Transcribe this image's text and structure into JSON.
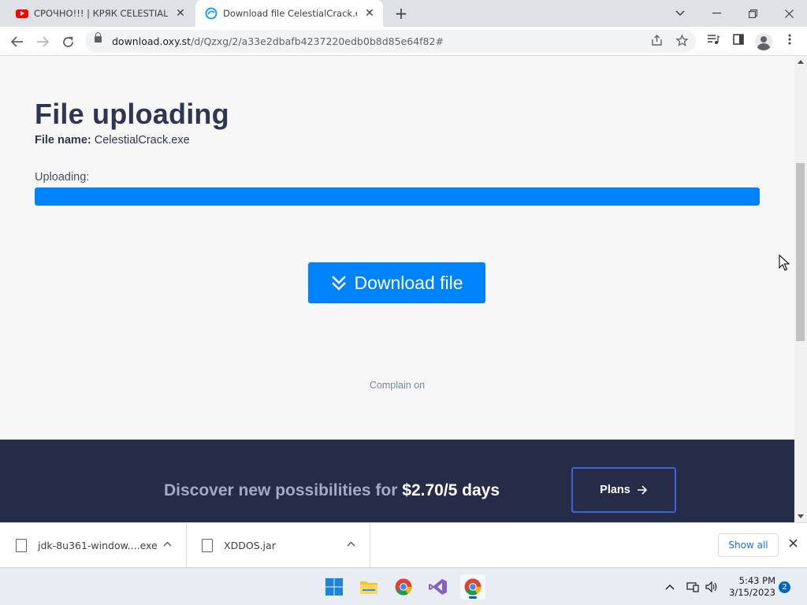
{
  "browser": {
    "tabs": [
      {
        "title": "СРОЧНО!!! | КРЯК CELESTIAL RECODE",
        "icon": "youtube-icon",
        "active": false
      },
      {
        "title": "Download file CelestialCrack.exe",
        "icon": "oxy-icon",
        "active": true
      }
    ],
    "new_tab_symbol": "+",
    "url_host": "download.oxy.st",
    "url_path": "/d/Qzxg/2/a33e2dbafb4237220edb0b8d85e64f82#"
  },
  "page": {
    "title": "File uploading",
    "file_name_label": "File name:",
    "file_name": "CelestialCrack.exe",
    "uploading_label": "Uploading:",
    "progress_percent": 100,
    "download_button": "Download file",
    "complain_text": "Complain on",
    "promo_text": "Discover new possibilities for ",
    "promo_price": "$2.70/5 days",
    "plans_button": "Plans",
    "accent_color": "#0083fa",
    "promo_bg_color": "#262b47"
  },
  "downloads": {
    "items": [
      {
        "name": "jdk-8u361-window....exe"
      },
      {
        "name": "XDDOS.jar"
      }
    ],
    "show_all": "Show all"
  },
  "taskbar": {
    "apps": [
      "windows-start-icon",
      "file-explorer-icon",
      "chrome-icon",
      "visual-studio-icon",
      "chrome-icon"
    ],
    "time": "5:43 PM",
    "date": "3/15/2023",
    "notification_count": "2"
  }
}
